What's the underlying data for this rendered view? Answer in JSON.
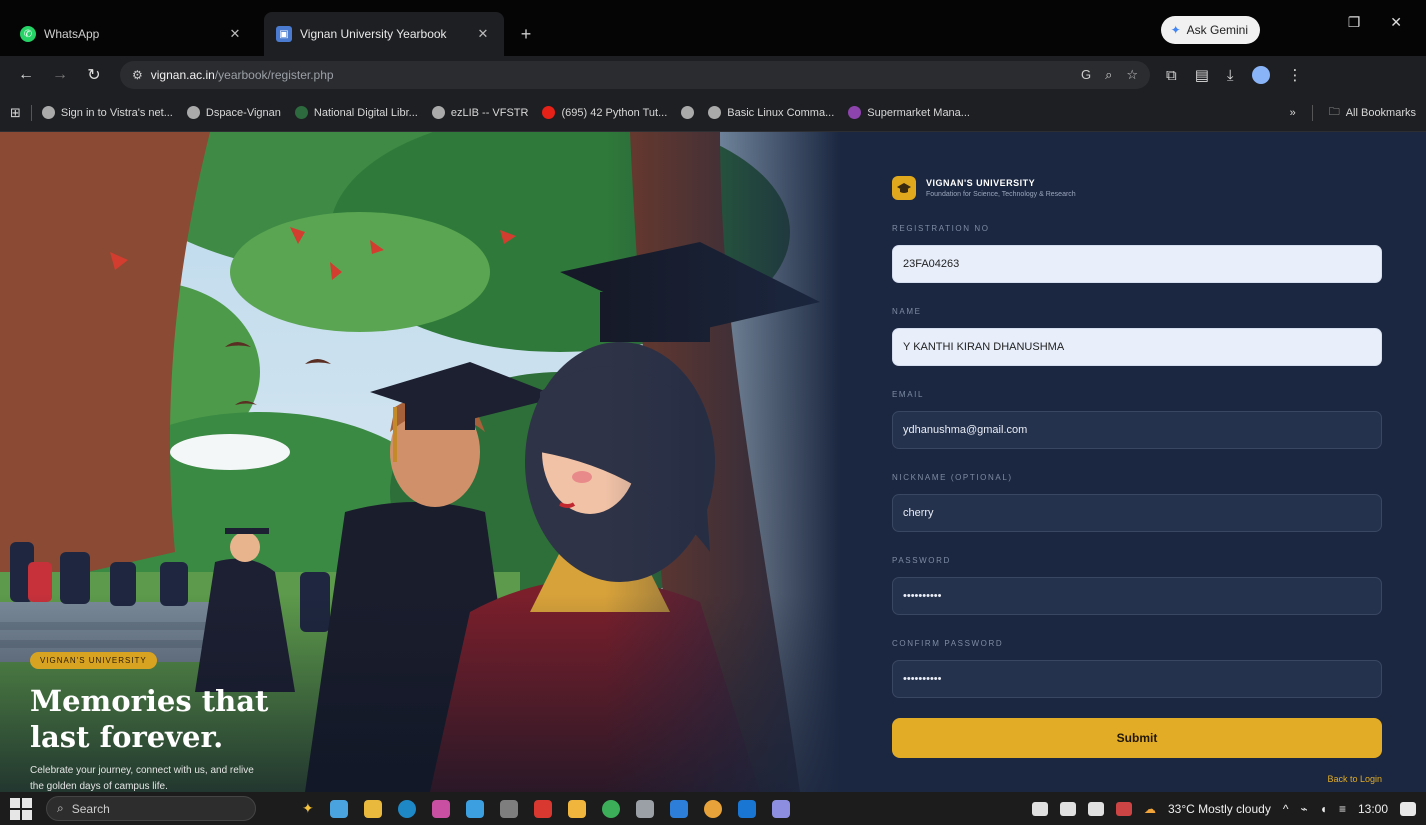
{
  "browser": {
    "tabs": [
      {
        "title": "WhatsApp",
        "active": false
      },
      {
        "title": "Vignan University Yearbook",
        "active": true
      }
    ],
    "ask_gemini": "Ask Gemini",
    "url_domain": "vignan.ac.in",
    "url_path": "/yearbook/register.php",
    "bookmarks": [
      "Sign in to Vistra's net...",
      "Dspace-Vignan",
      "National Digital Libr...",
      "ezLIB -- VFSTR",
      "(695) 42 Python Tut...",
      "Basic Linux Comma...",
      "Supermarket Mana..."
    ],
    "all_bookmarks": "All Bookmarks"
  },
  "hero": {
    "badge": "VIGNAN'S UNIVERSITY",
    "title_line1": "Memories that",
    "title_line2": "last forever.",
    "subtitle": "Celebrate your journey, connect with us, and relive the golden days of campus life."
  },
  "brand": {
    "name": "VIGNAN'S UNIVERSITY",
    "tagline": "Foundation for Science, Technology & Research"
  },
  "form": {
    "registration_label": "REGISTRATION NO",
    "registration_value": "23FA04263",
    "name_label": "NAME",
    "name_value": "Y KANTHI KIRAN DHANUSHMA",
    "email_label": "EMAIL",
    "email_value": "ydhanushma@gmail.com",
    "nickname_label": "NICKNAME (OPTIONAL)",
    "nickname_value": "cherry",
    "password_label": "PASSWORD",
    "password_value": "••••••••••",
    "confirm_label": "CONFIRM PASSWORD",
    "confirm_value": "••••••••••",
    "submit_label": "Submit",
    "back_link": "Back to Login"
  },
  "taskbar": {
    "search_placeholder": "Search",
    "weather": "33°C  Mostly cloudy",
    "time": "13:00"
  },
  "colors": {
    "panel_bg": "#1b2740",
    "accent_gold": "#e2ac26",
    "input_filled": "#e8effb"
  }
}
